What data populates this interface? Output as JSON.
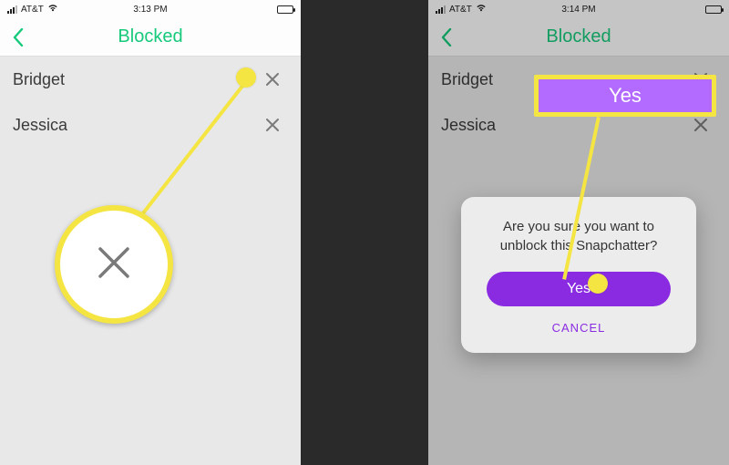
{
  "status": {
    "carrier": "AT&T",
    "wifi": true
  },
  "nav": {
    "title": "Blocked"
  },
  "left": {
    "time": "3:13 PM",
    "rows": [
      {
        "name": "Bridget"
      },
      {
        "name": "Jessica"
      }
    ]
  },
  "right": {
    "time": "3:14 PM",
    "rows": [
      {
        "name": "Bridget"
      },
      {
        "name": "Jessica"
      }
    ],
    "dialog": {
      "message_l1": "Are you sure you want to",
      "message_l2": "unblock this Snapchatter?",
      "yes": "Yes",
      "cancel": "CANCEL"
    },
    "callout_yes": "Yes"
  }
}
